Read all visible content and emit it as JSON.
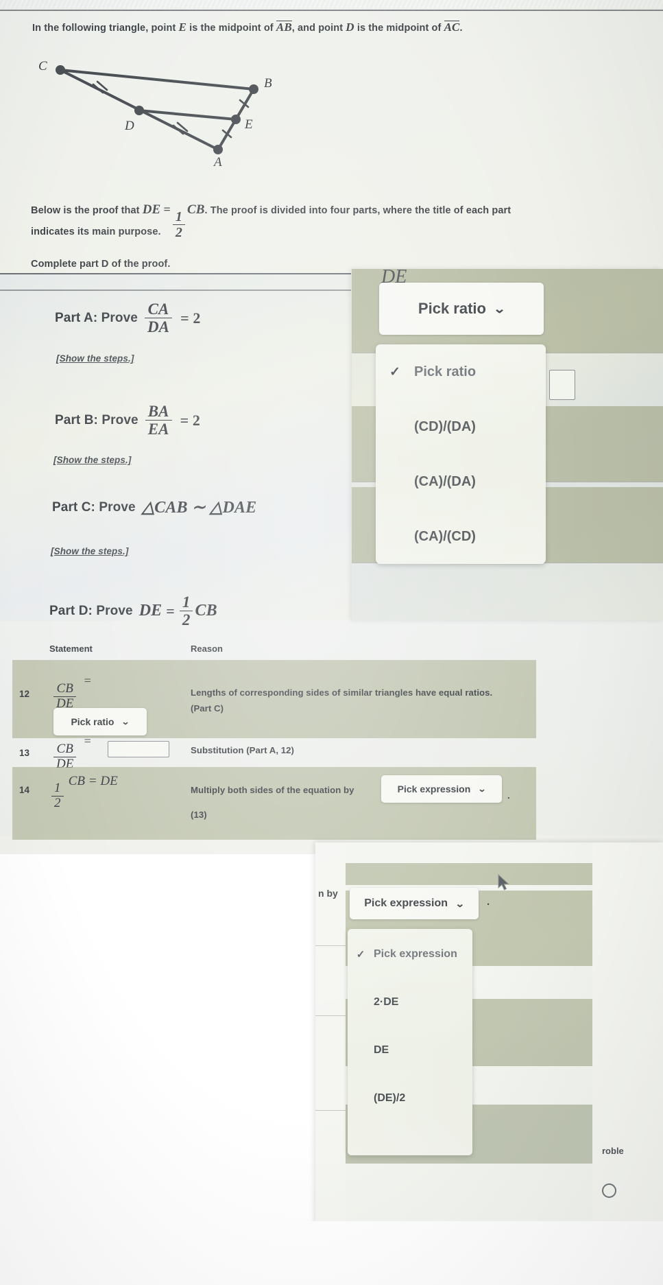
{
  "prompt": {
    "line1_a": "In the following triangle, point ",
    "line1_E": "E",
    "line1_b": " is the midpoint of ",
    "line1_AB": "AB",
    "line1_c": ", and point ",
    "line1_D": "D",
    "line1_d": " is the midpoint of ",
    "line1_AC": "AC",
    "line1_e": "."
  },
  "figure": {
    "labels": [
      "C",
      "B",
      "D",
      "E",
      "A"
    ],
    "tick_marks": [
      "double",
      "double",
      "single",
      "single"
    ]
  },
  "body": {
    "below_a": "Below is the proof that ",
    "below_DE": "DE",
    "below_eq": "=",
    "below_num": "1",
    "below_den": "2",
    "below_CB": "CB",
    "below_b": ". The proof is divided into four parts, where the title of each part",
    "below_c": "indicates its main purpose.",
    "complete": "Complete part D of the proof."
  },
  "parts": {
    "a": {
      "title": "Part A: Prove",
      "num": "CA",
      "den": "DA",
      "eq": "= 2",
      "steps": "[Show the steps.]"
    },
    "b": {
      "title": "Part B: Prove",
      "num": "BA",
      "den": "EA",
      "eq": "= 2",
      "steps": "[Show the steps.]"
    },
    "c": {
      "title": "Part C: Prove",
      "expr": "△CAB ∼ △DAE",
      "steps": "[Show the steps.]"
    },
    "d": {
      "title": "Part D: Prove",
      "lhs": "DE",
      "eq": "=",
      "num": "1",
      "den": "2",
      "rhs": "CB"
    }
  },
  "table": {
    "headers": {
      "statement": "Statement",
      "reason": "Reason"
    },
    "rows": [
      {
        "num": "12",
        "stmt_num": "CB",
        "stmt_den": "DE",
        "stmt_eq": "=",
        "control": "Pick ratio",
        "reason_line1": "Lengths of corresponding sides of similar triangles have equal ratios.",
        "reason_line2": "(Part C)"
      },
      {
        "num": "13",
        "stmt_num": "CB",
        "stmt_den": "DE",
        "stmt_eq": "=",
        "control": "",
        "reason_line1": "Substitution (Part A, 12)",
        "reason_line2": ""
      },
      {
        "num": "14",
        "stmt_frac_num": "1",
        "stmt_frac_den": "2",
        "stmt_rest": "CB = DE",
        "reason_line1": "Multiply both sides of the equation by",
        "control": "Pick expression",
        "reason_suffix": ".",
        "reason_line2": "(13)"
      }
    ]
  },
  "dropdown_ratio": {
    "button_label": "Pick ratio",
    "chevron": "⌄",
    "check": "✓",
    "ghost_text": "DE",
    "options": [
      "Pick ratio",
      "(CD)/(DA)",
      "(CA)/(DA)",
      "(CA)/(CD)"
    ],
    "selected": "Pick ratio"
  },
  "dropdown_expression": {
    "button_label": "Pick expression",
    "chevron": "⌄",
    "check": "✓",
    "reason_prefix": "n by",
    "reason_suffix": ".",
    "options": [
      "Pick expression",
      "2·DE",
      "DE",
      "(DE)/2"
    ],
    "selected": "Pick expression",
    "partial_text_right": "roble"
  },
  "colors": {
    "row_shade": "#a9b092",
    "text": "#3b4045",
    "control_bg": "#f7f8f4"
  }
}
